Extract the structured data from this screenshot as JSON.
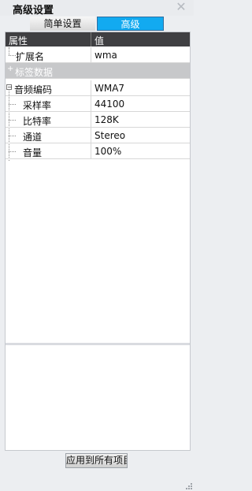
{
  "window": {
    "title": "高级设置",
    "close_glyph": "✕"
  },
  "tabs": [
    {
      "label": "简单设置",
      "active": false
    },
    {
      "label": "高级",
      "active": true
    }
  ],
  "grid": {
    "header": {
      "property": "属性",
      "value": "值"
    },
    "rows": [
      {
        "name": "扩展名",
        "value": "wma"
      },
      {
        "name": "标签数据",
        "group": true,
        "expander": "+"
      },
      {
        "name": "音频编码",
        "value": "WMA7",
        "expander": "−"
      },
      {
        "name": "采样率",
        "value": "44100"
      },
      {
        "name": "比特率",
        "value": "128K"
      },
      {
        "name": "通道",
        "value": "Stereo"
      },
      {
        "name": "音量",
        "value": "100%"
      }
    ]
  },
  "footer": {
    "apply_label": "应用到所有项目"
  },
  "colors": {
    "accent": "#12aaf0",
    "header_bg": "#3f3f42",
    "group_bg": "#c7c8ca"
  }
}
